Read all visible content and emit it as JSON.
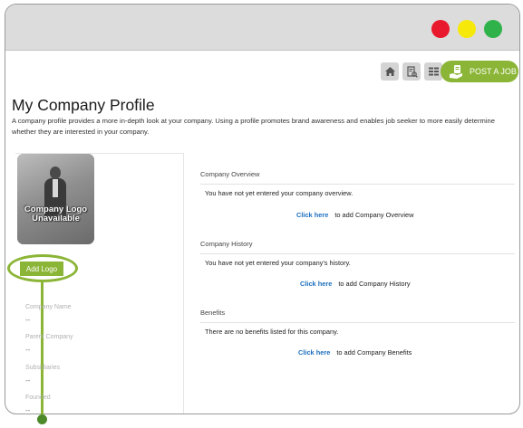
{
  "window": {
    "colors": {
      "close": "#e8192c",
      "minimize": "#f6e90a",
      "maximize": "#2fb24a"
    }
  },
  "toolbar": {
    "icons": [
      "home-icon",
      "search-document-icon",
      "list-icon"
    ],
    "post_job_label": "POST A JOB",
    "accent": "#8bb536"
  },
  "page": {
    "title": "My Company Profile",
    "description": "A company profile provides a more in-depth look at your company. Using a profile promotes brand awareness and enables job seeker to more easily determine whether they are interested in your company."
  },
  "logo": {
    "placeholder_text": "Company Logo Unavailable",
    "add_logo_label": "Add Logo"
  },
  "fields": [
    {
      "label": "Company Name",
      "value": "--"
    },
    {
      "label": "Parent Company",
      "value": "--"
    },
    {
      "label": "Subsidiaries",
      "value": "--"
    },
    {
      "label": "Founded",
      "value": "--"
    }
  ],
  "sections": [
    {
      "title": "Company Overview",
      "message": "You have not yet entered your company overview.",
      "link": "Click here",
      "link_suffix": "to add Company Overview"
    },
    {
      "title": "Company History",
      "message": "You have not yet entered your company's history.",
      "link": "Click here",
      "link_suffix": "to add Company History"
    },
    {
      "title": "Benefits",
      "message": "There are no benefits listed for this company.",
      "link": "Click here",
      "link_suffix": "to add Company Benefits"
    }
  ]
}
